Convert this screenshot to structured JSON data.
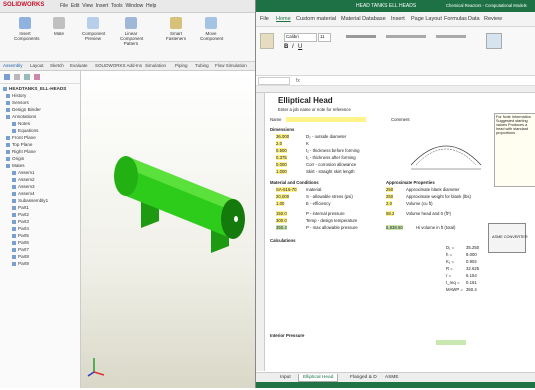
{
  "solidworks": {
    "logo": "SOLIDWORKS",
    "menu": [
      "File",
      "Edit",
      "View",
      "Insert",
      "Tools",
      "Window",
      "Help"
    ],
    "ribbon": [
      {
        "label": "Insert Components",
        "icon": "insert-components-icon"
      },
      {
        "label": "Mate",
        "icon": "mate-icon"
      },
      {
        "label": "Component Preview",
        "icon": "preview-icon"
      },
      {
        "label": "Linear Component Pattern",
        "icon": "pattern-icon"
      },
      {
        "label": "Smart Fasteners",
        "icon": "fastener-icon"
      },
      {
        "label": "Move Component",
        "icon": "move-icon"
      }
    ],
    "tabs": [
      "Assembly",
      "Layout",
      "Sketch",
      "Evaluate",
      "SOLIDWORKS Add-Ins",
      "Simulation",
      "Piping",
      "Tubing",
      "Flow Simulation"
    ],
    "tree": {
      "root": "HEADTANKS_ELL-HEADS",
      "items": [
        "History",
        "Sensors",
        "Design Binder",
        "Annotations",
        "Notes",
        "Equations",
        "Front Plane",
        "Top Plane",
        "Right Plane",
        "Origin",
        "Mates",
        "Assem1",
        "Assem2",
        "Assem3",
        "Assem4",
        "Subassembly1",
        "Part1",
        "Part2",
        "Part3",
        "Part4",
        "Part5",
        "Part6",
        "Part7",
        "Part8",
        "Part9"
      ]
    }
  },
  "excel": {
    "title": "HEAD TANKS ELL HEADS",
    "title_right": "Chemical Reactors - Computational Models",
    "tabs": [
      "File",
      "Home",
      "Custom material",
      "Material Database",
      "Insert",
      "Page Layout",
      "Formulas",
      "Data",
      "Review"
    ],
    "active_tab": "Home",
    "font_name": "Calibri",
    "font_size": "11",
    "sheet_title": "Elliptical Head",
    "sheet_subtitle": "Enter a job name or note for reference",
    "labels": {
      "dims_header": "Dimensions",
      "material_header": "Material and Conditions",
      "approx_header": "Approximate Properties",
      "calculations": "Calculations",
      "internal": "Interior Pressure",
      "name_label": "Name",
      "comment_label": "Comment"
    },
    "dims": [
      {
        "value": "36.000",
        "desc": "D₂ - outside diameter"
      },
      {
        "value": "2.0",
        "desc": "K"
      },
      {
        "value": "0.500",
        "desc": "t₂ - thickness before forming"
      },
      {
        "value": "0.375",
        "desc": "t₁ - thickness after forming"
      },
      {
        "value": "0.000",
        "desc": "Corr - corrosion allowance"
      },
      {
        "value": "1.000",
        "desc": "Skirt - straight skirt length"
      }
    ],
    "material": [
      {
        "value": "SA-516-70",
        "desc": "material"
      },
      {
        "value": "20,000",
        "desc": "S - allowable stress (psi)"
      },
      {
        "value": "1.00",
        "desc": "E - efficiency"
      },
      {
        "value": "150.0",
        "desc": "P - internal pressure"
      },
      {
        "value": "300.0",
        "desc": "Temp - design temperature"
      },
      {
        "value": "350.4",
        "desc": "P - max allowable pressure"
      }
    ],
    "approx": [
      {
        "value": "250",
        "desc": "Approximate blank diameter"
      },
      {
        "value": "250",
        "desc": "Approximate weight for blank (lbs)"
      },
      {
        "value": "2.0",
        "desc": "Volume (cu ft)"
      },
      {
        "value": "58.2",
        "desc": "Volume head and 0 (ft³)"
      },
      {
        "value": "6,838.60",
        "desc": "Hi volume in ft (total)"
      }
    ],
    "results": [
      {
        "label": "D₁ =",
        "value": "35.250"
      },
      {
        "label": "h =",
        "value": "9.000"
      },
      {
        "label": "K₁ =",
        "value": "0.902"
      },
      {
        "label": "R =",
        "value": "32.625"
      },
      {
        "label": "r =",
        "value": "6.154"
      },
      {
        "label": "t_req =",
        "value": "0.161"
      },
      {
        "label": "MAWP =",
        "value": "350.4"
      }
    ],
    "sheet_tabs": [
      "Input",
      "Elliptical Head",
      "Flanged & D",
      "ASME"
    ],
    "active_sheet": "Elliptical Head",
    "note_label": "ASME CONVERTER",
    "note_side": "For Note Information Suggested starting values Produces a head with standard proportions"
  },
  "colors": {
    "tank": "#2ecc1a",
    "tank_dark": "#157a0c",
    "excel_green": "#1e7145",
    "yellow_cell": "#fff38a",
    "sw_red": "#c8102e"
  }
}
